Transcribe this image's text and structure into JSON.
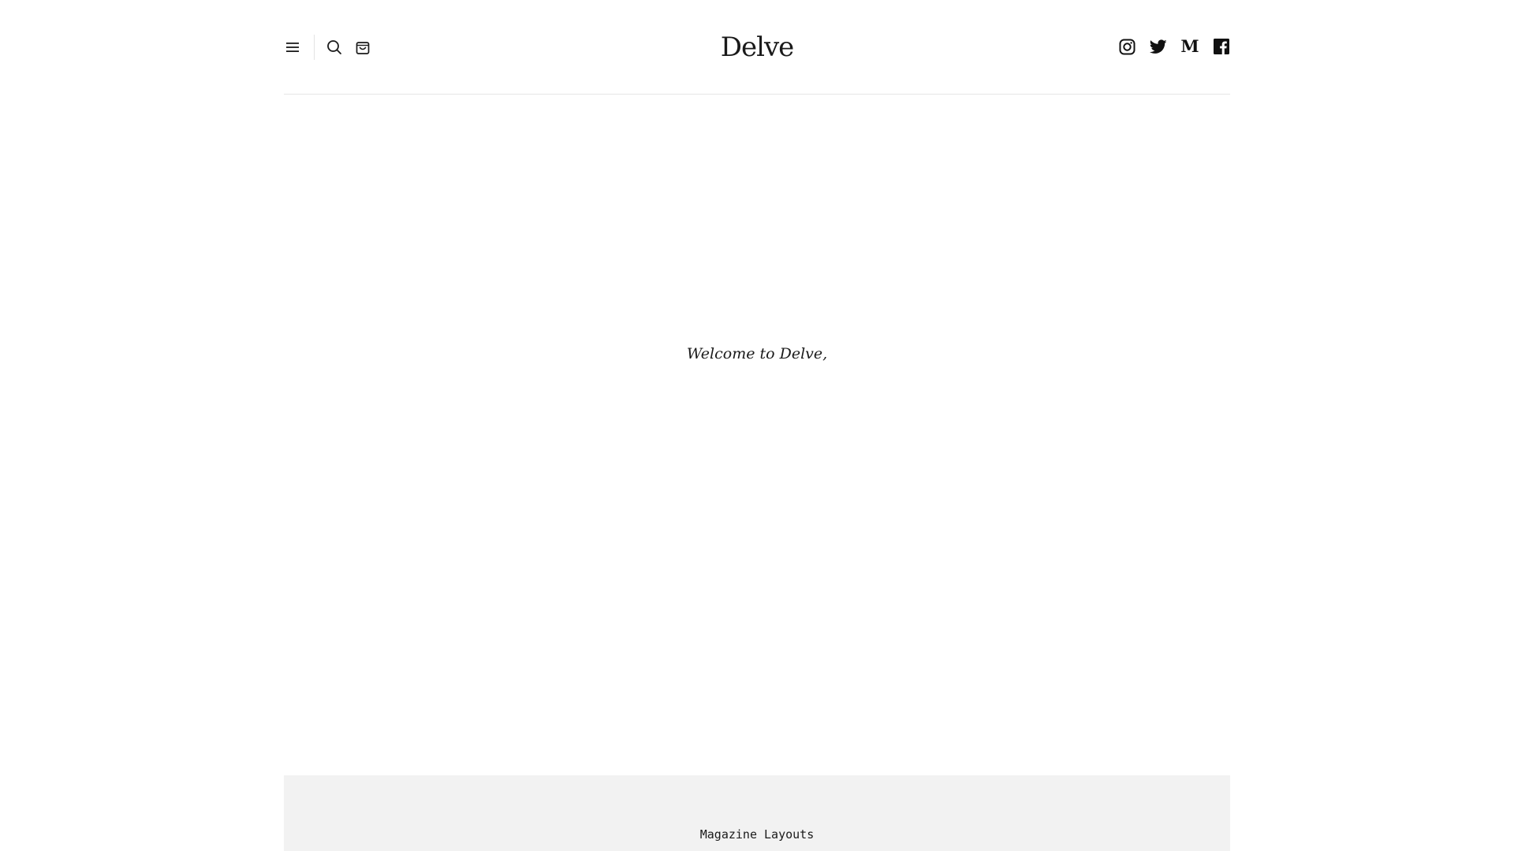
{
  "header": {
    "logo": "Delve",
    "left_icons": [
      "menu-icon",
      "search-icon",
      "cart-icon"
    ],
    "social_icons": [
      "instagram-icon",
      "twitter-icon",
      "medium-icon",
      "facebook-icon"
    ],
    "medium_glyph": "M"
  },
  "hero": {
    "greeting": "Welcome to Delve,"
  },
  "band": {
    "label": "Magazine Layouts",
    "background": "#f2f2f2"
  },
  "colors": {
    "text": "#1a1a1a",
    "divider": "#e6e6e6",
    "background": "#ffffff"
  }
}
